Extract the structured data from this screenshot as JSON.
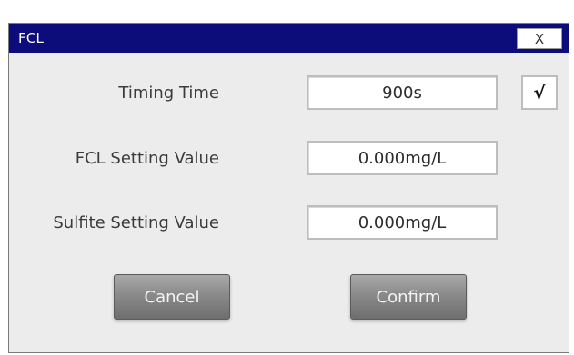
{
  "dialog": {
    "title": "FCL",
    "close_label": "X",
    "title_bar_color": "#0c0c7a"
  },
  "fields": [
    {
      "label": "Timing Time",
      "value": "900s"
    },
    {
      "label": "FCL Setting Value",
      "value": "0.000mg/L"
    },
    {
      "label": "Sulfite Setting Value",
      "value": "0.000mg/L"
    }
  ],
  "timing_checkbox": {
    "mark": "√",
    "checked": true
  },
  "buttons": {
    "cancel_label": "Cancel",
    "confirm_label": "Confirm"
  }
}
